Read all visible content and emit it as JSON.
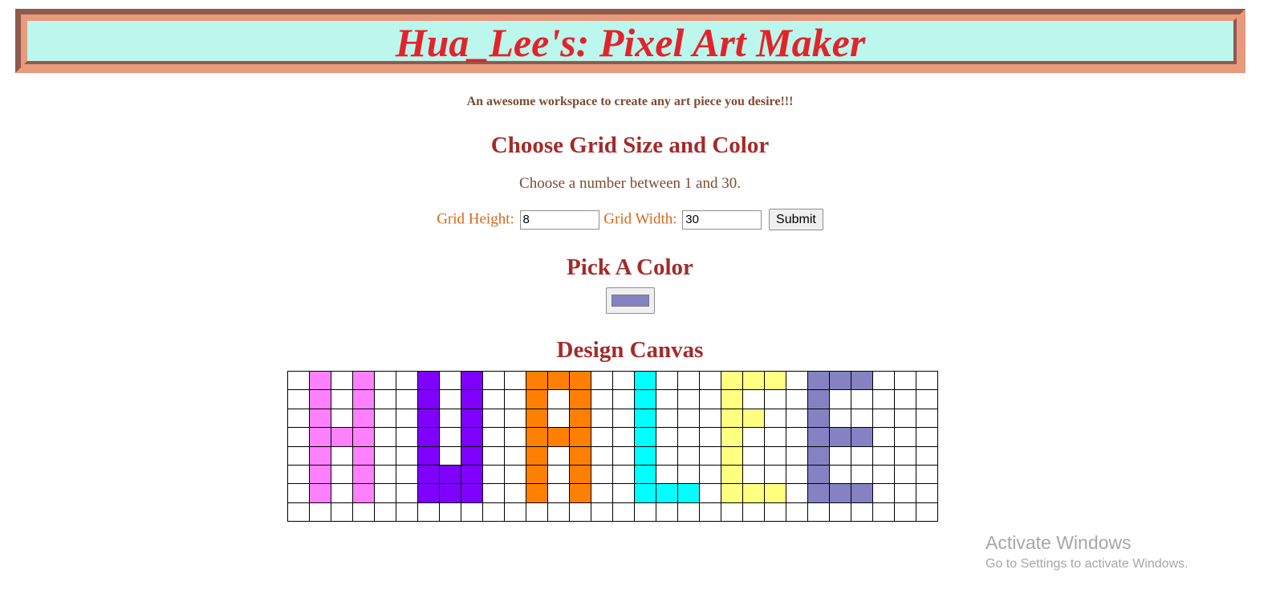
{
  "header": {
    "title": "Hua_Lee's: Pixel Art Maker",
    "tagline": "An awesome workspace to create any art piece you desire!!!"
  },
  "grid_section": {
    "heading": "Choose Grid Size and Color",
    "instructions": "Choose a number between 1 and 30.",
    "height_label": "Grid Height:",
    "height_value": "8",
    "width_label": "Grid Width:",
    "width_value": "30",
    "submit_label": "Submit"
  },
  "color_section": {
    "heading": "Pick A Color",
    "selected_color": "#8581c2"
  },
  "canvas_section": {
    "heading": "Design Canvas",
    "rows": 8,
    "cols": 30,
    "palette": {
      "M": "#ff80ff",
      "P": "#8000ff",
      "O": "#ff8000",
      "C": "#00ffff",
      "Y": "#ffff80",
      "V": "#8581c2"
    },
    "pixels": [
      ".M.M..P.P..OOO..C...YYY.VVV...",
      ".M.M..P.P..O.O..C...Y...V.....",
      ".M.M..P.P..O.O..C...YY..V.....",
      ".MMM..P.P..OOO..C...Y...VVV...",
      ".M.M..P.P..O.O..C...Y...V.....",
      ".M.M..PPP..O.O..C...Y...V.....",
      ".M.M..PPP..O.O..CCC.YYY.VVV...",
      ".............................."
    ]
  },
  "watermark": {
    "line1": "Activate Windows",
    "line2": "Go to Settings to activate Windows."
  }
}
